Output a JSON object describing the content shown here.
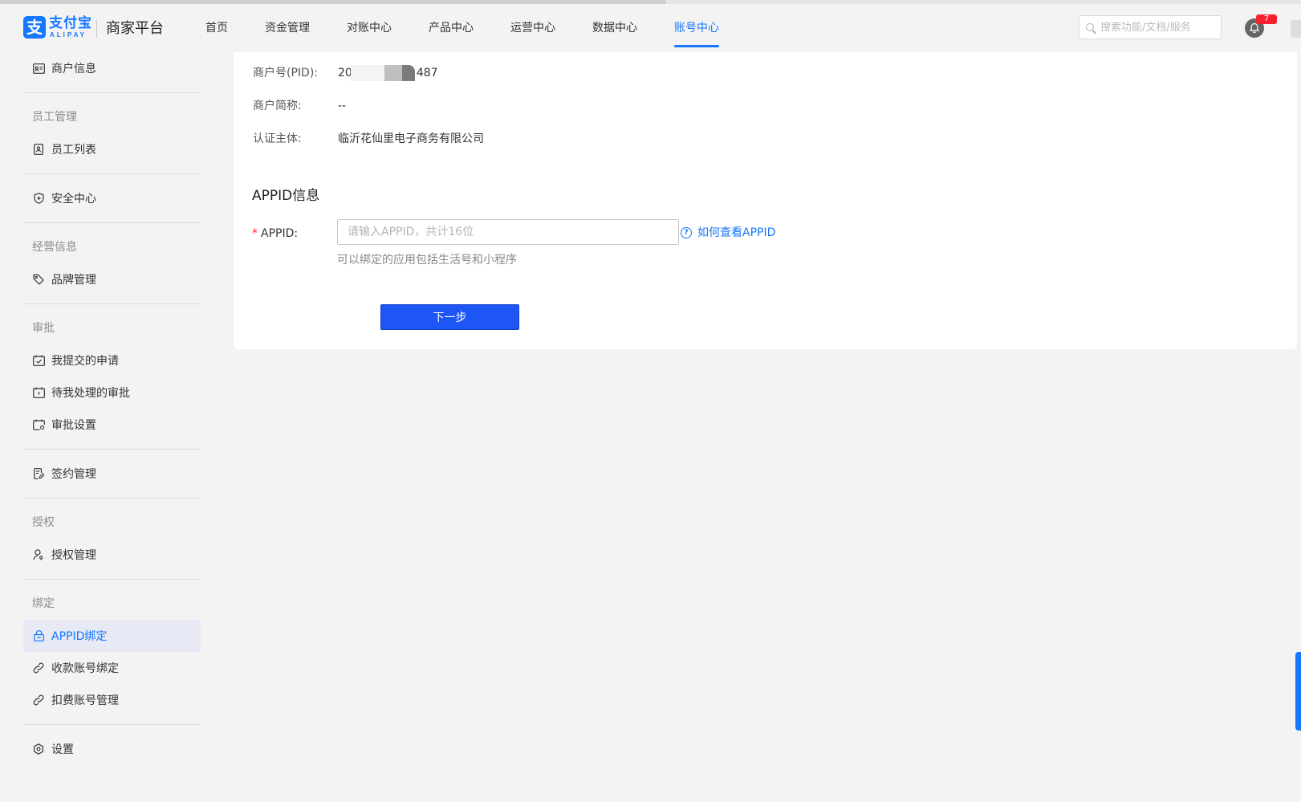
{
  "brand": {
    "logo_cn": "支付宝",
    "logo_en": "ALIPAY",
    "platform": "商家平台",
    "accent": "#1677ff"
  },
  "nav": {
    "items": [
      {
        "label": "首页"
      },
      {
        "label": "资金管理"
      },
      {
        "label": "对账中心"
      },
      {
        "label": "产品中心"
      },
      {
        "label": "运营中心"
      },
      {
        "label": "数据中心"
      },
      {
        "label": "账号中心",
        "active": true
      }
    ]
  },
  "search": {
    "placeholder": "搜索功能/文档/服务",
    "icon": "search-icon"
  },
  "notifications": {
    "count": "7",
    "icon": "bell-icon"
  },
  "sidebar": {
    "items": [
      {
        "label": "商户信息",
        "icon": "id-card-icon"
      },
      {
        "label": "员工管理"
      },
      {
        "label": "员工列表",
        "icon": "badge-icon"
      },
      {
        "label": "安全中心",
        "icon": "shield-icon"
      },
      {
        "label": "经营信息"
      },
      {
        "label": "品牌管理",
        "icon": "tag-icon"
      },
      {
        "label": "审批"
      },
      {
        "label": "我提交的申请",
        "icon": "calendar-check-icon"
      },
      {
        "label": "待我处理的审批",
        "icon": "calendar-icon"
      },
      {
        "label": "审批设置",
        "icon": "calendar-gear-icon"
      },
      {
        "label": "签约管理",
        "icon": "contract-icon"
      },
      {
        "label": "授权"
      },
      {
        "label": "授权管理",
        "icon": "user-key-icon"
      },
      {
        "label": "绑定"
      },
      {
        "label": "APPID绑定",
        "icon": "lock-icon",
        "active": true
      },
      {
        "label": "收款账号绑定",
        "icon": "link-icon"
      },
      {
        "label": "扣费账号管理",
        "icon": "link-icon"
      },
      {
        "label": "设置",
        "icon": "settings-icon"
      }
    ]
  },
  "merchant": {
    "pid_label": "商户号(PID):",
    "pid_prefix": "20",
    "pid_suffix": "487",
    "short_name_label": "商户简称:",
    "short_name_value": "--",
    "entity_label": "认证主体:",
    "entity_value": "临沂花仙里电子商务有限公司"
  },
  "appid_section": {
    "title": "APPID信息",
    "required_mark": "*",
    "label": "APPID:",
    "input_value": "",
    "input_placeholder": "请输入APPID，共计16位",
    "help_link": "如何查看APPID",
    "help_icon": "question-circle-icon",
    "hint": "可以绑定的应用包括生活号和小程序",
    "next_button": "下一步"
  }
}
